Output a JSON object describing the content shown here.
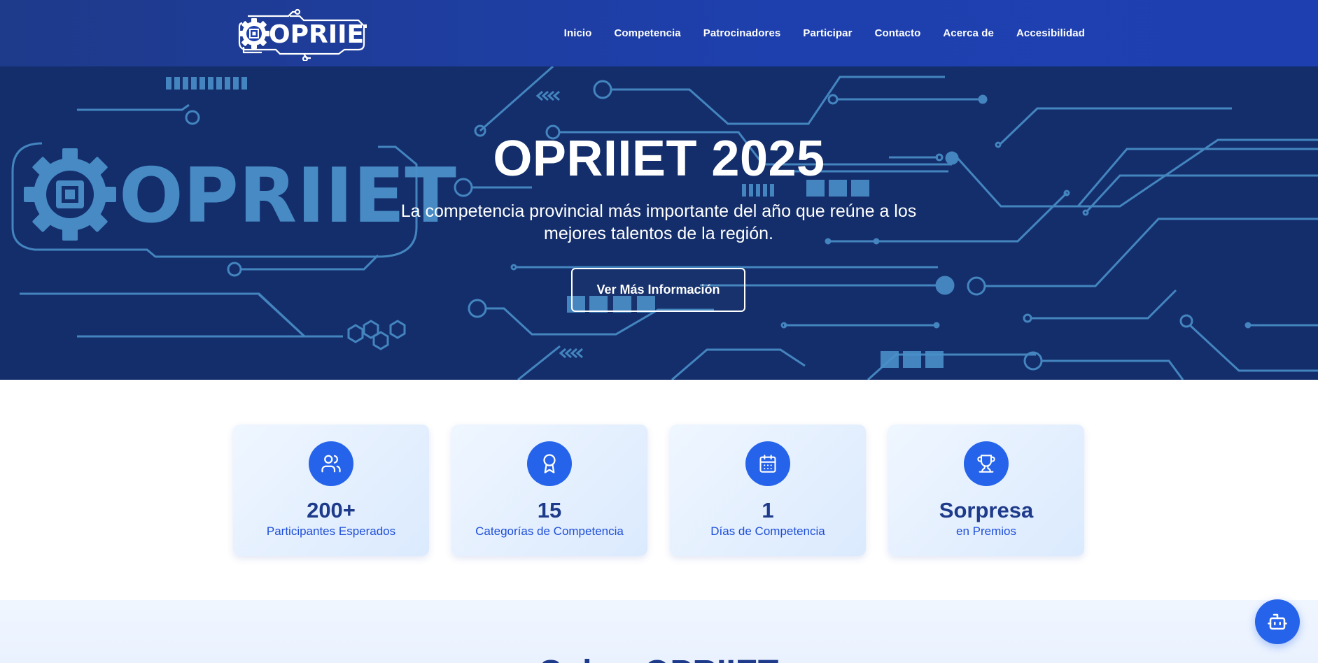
{
  "header": {
    "logo_text": "OPRIIET",
    "nav": [
      "Inicio",
      "Competencia",
      "Patrocinadores",
      "Participar",
      "Contacto",
      "Acerca de",
      "Accesibilidad"
    ]
  },
  "hero": {
    "title": "OPRIIET 2025",
    "subtitle": "La competencia provincial más importante del año que reúne a los mejores talentos de la región.",
    "button_label": "Ver Más Información",
    "background_logo_text": "OPRIIET"
  },
  "stats": [
    {
      "value": "200+",
      "label": "Participantes Esperados",
      "icon": "users-icon"
    },
    {
      "value": "15",
      "label": "Categorías de Competencia",
      "icon": "award-icon"
    },
    {
      "value": "1",
      "label": "Días de Competencia",
      "icon": "calendar-icon"
    },
    {
      "value": "Sorpresa",
      "label": "en Premios",
      "icon": "trophy-icon"
    }
  ],
  "about": {
    "title": "Sobre OPRIIET"
  },
  "chatbot": {
    "icon": "bot-icon"
  },
  "colors": {
    "header_bg": "#1e40af",
    "hero_bg": "#132e6b",
    "circuit": "#4a8fc9",
    "accent": "#2563eb",
    "stat_text": "#1e3a8a"
  }
}
